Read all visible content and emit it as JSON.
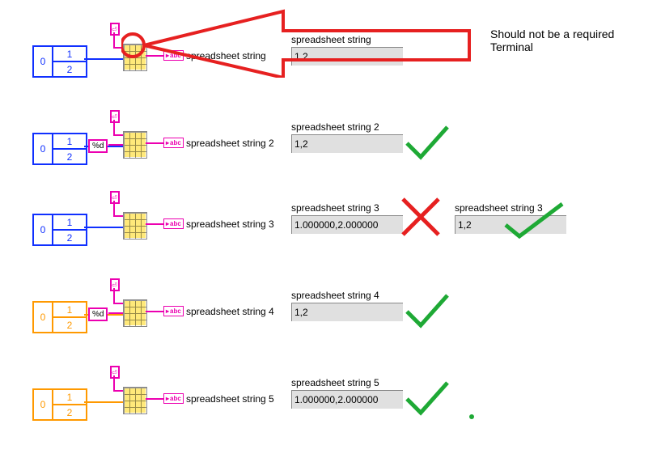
{
  "caption": "Should not be a required Terminal",
  "rows": [
    {
      "id": 1,
      "array_type": "i32",
      "array_values": [
        1,
        2
      ],
      "format_string": null,
      "delimiter": ",",
      "bd_indicator_label": "spreadsheet string",
      "fp": {
        "label": "spreadsheet string",
        "value": "1,2"
      },
      "marks": [],
      "note": "red-arrow-target",
      "fp2": null
    },
    {
      "id": 2,
      "array_type": "i32",
      "array_values": [
        1,
        2
      ],
      "format_string": "%d",
      "delimiter": ",",
      "bd_indicator_label": "spreadsheet string 2",
      "fp": {
        "label": "spreadsheet string 2",
        "value": "1,2"
      },
      "marks": [
        "check"
      ],
      "fp2": null
    },
    {
      "id": 3,
      "array_type": "i32",
      "array_values": [
        1,
        2
      ],
      "format_string": null,
      "delimiter": ",",
      "bd_indicator_label": "spreadsheet string 3",
      "fp": {
        "label": "spreadsheet string 3",
        "value": "1.000000,2.000000"
      },
      "marks": [
        "cross"
      ],
      "fp2": {
        "label": "spreadsheet string 3",
        "value": "1,2",
        "marks": [
          "check"
        ]
      }
    },
    {
      "id": 4,
      "array_type": "dbl",
      "array_values": [
        1,
        2
      ],
      "format_string": "%d",
      "delimiter": ",",
      "bd_indicator_label": "spreadsheet string 4",
      "fp": {
        "label": "spreadsheet string 4",
        "value": "1,2"
      },
      "marks": [
        "check"
      ],
      "fp2": null
    },
    {
      "id": 5,
      "array_type": "dbl",
      "array_values": [
        1,
        2
      ],
      "format_string": null,
      "delimiter": ",",
      "bd_indicator_label": "spreadsheet string 5",
      "fp": {
        "label": "spreadsheet string 5",
        "value": "1.000000,2.000000"
      },
      "marks": [
        "check"
      ],
      "fp2": null
    }
  ],
  "colors": {
    "i32": "#1030ff",
    "dbl": "#ff9900",
    "string": "#ec00b0",
    "annotation_red": "#e62020",
    "annotation_green": "#1ea935"
  },
  "function_node": "Array To Spreadsheet String",
  "array_index_shown": 0
}
